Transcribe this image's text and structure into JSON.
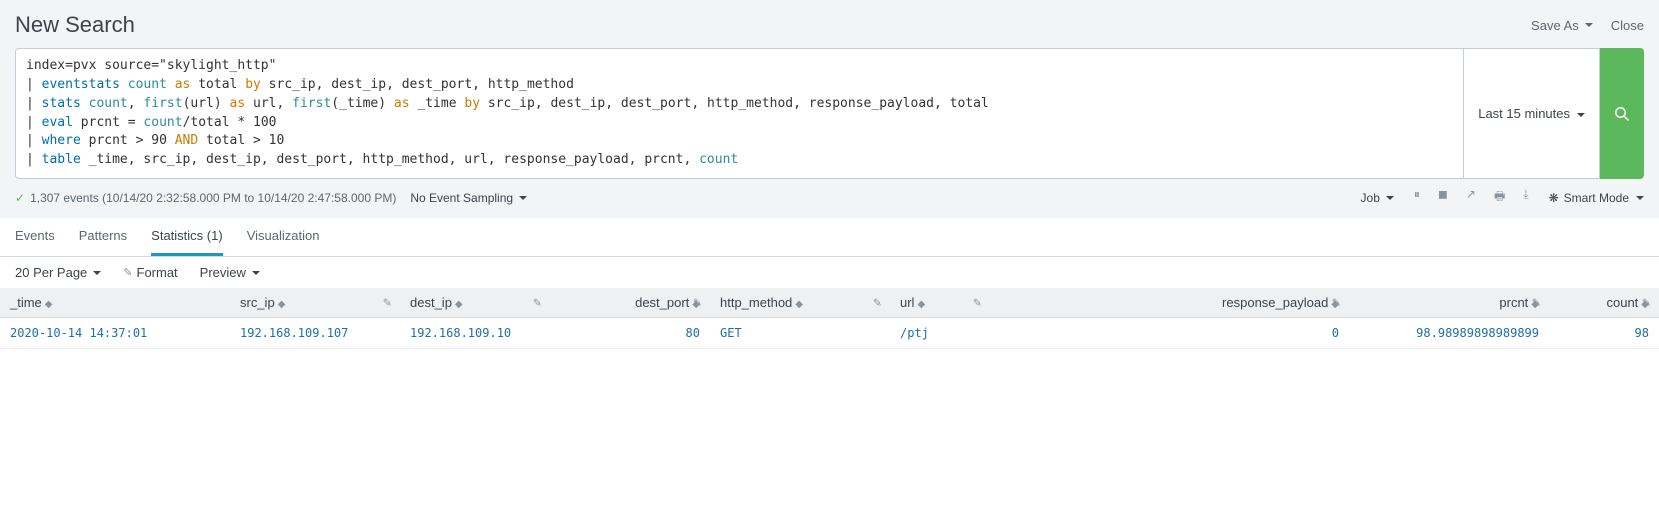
{
  "header": {
    "title": "New Search",
    "save_as": "Save As",
    "close": "Close"
  },
  "search": {
    "query_plain": "index=pvx source=\"skylight_http\"\n| eventstats count as total by src_ip, dest_ip, dest_port, http_method\n| stats count, first(url) as url, first(_time) as _time by src_ip, dest_ip, dest_port, http_method, response_payload, total\n| eval prcnt = count/total * 100\n| where prcnt > 90 AND total > 10\n| table _time, src_ip, dest_ip, dest_port, http_method, url, response_payload, prcnt, count",
    "time_label": "Last 15 minutes"
  },
  "status": {
    "events_text": "1,307 events (10/14/20 2:32:58.000 PM to 10/14/20 2:47:58.000 PM)",
    "no_sampling": "No Event Sampling",
    "job_label": "Job",
    "smart_mode": "Smart Mode"
  },
  "tabs": {
    "events": "Events",
    "patterns": "Patterns",
    "statistics": "Statistics (1)",
    "visualization": "Visualization"
  },
  "toolbar": {
    "per_page": "20 Per Page",
    "format": "Format",
    "preview": "Preview"
  },
  "table": {
    "headers": {
      "time": "_time",
      "src_ip": "src_ip",
      "dest_ip": "dest_ip",
      "dest_port": "dest_port",
      "http_method": "http_method",
      "url": "url",
      "response_payload": "response_payload",
      "prcnt": "prcnt",
      "count": "count"
    },
    "row": {
      "time": "2020-10-14 14:37:01",
      "src_ip": "192.168.109.107",
      "dest_ip": "192.168.109.10",
      "dest_port": "80",
      "http_method": "GET",
      "url": "/ptj",
      "response_payload": "0",
      "prcnt": "98.98989898989899",
      "count": "98"
    }
  },
  "chart_data": {
    "type": "table",
    "columns": [
      "_time",
      "src_ip",
      "dest_ip",
      "dest_port",
      "http_method",
      "url",
      "response_payload",
      "prcnt",
      "count"
    ],
    "rows": [
      [
        "2020-10-14 14:37:01",
        "192.168.109.107",
        "192.168.109.10",
        80,
        "GET",
        "/ptj",
        0,
        98.98989898989899,
        98
      ]
    ]
  }
}
